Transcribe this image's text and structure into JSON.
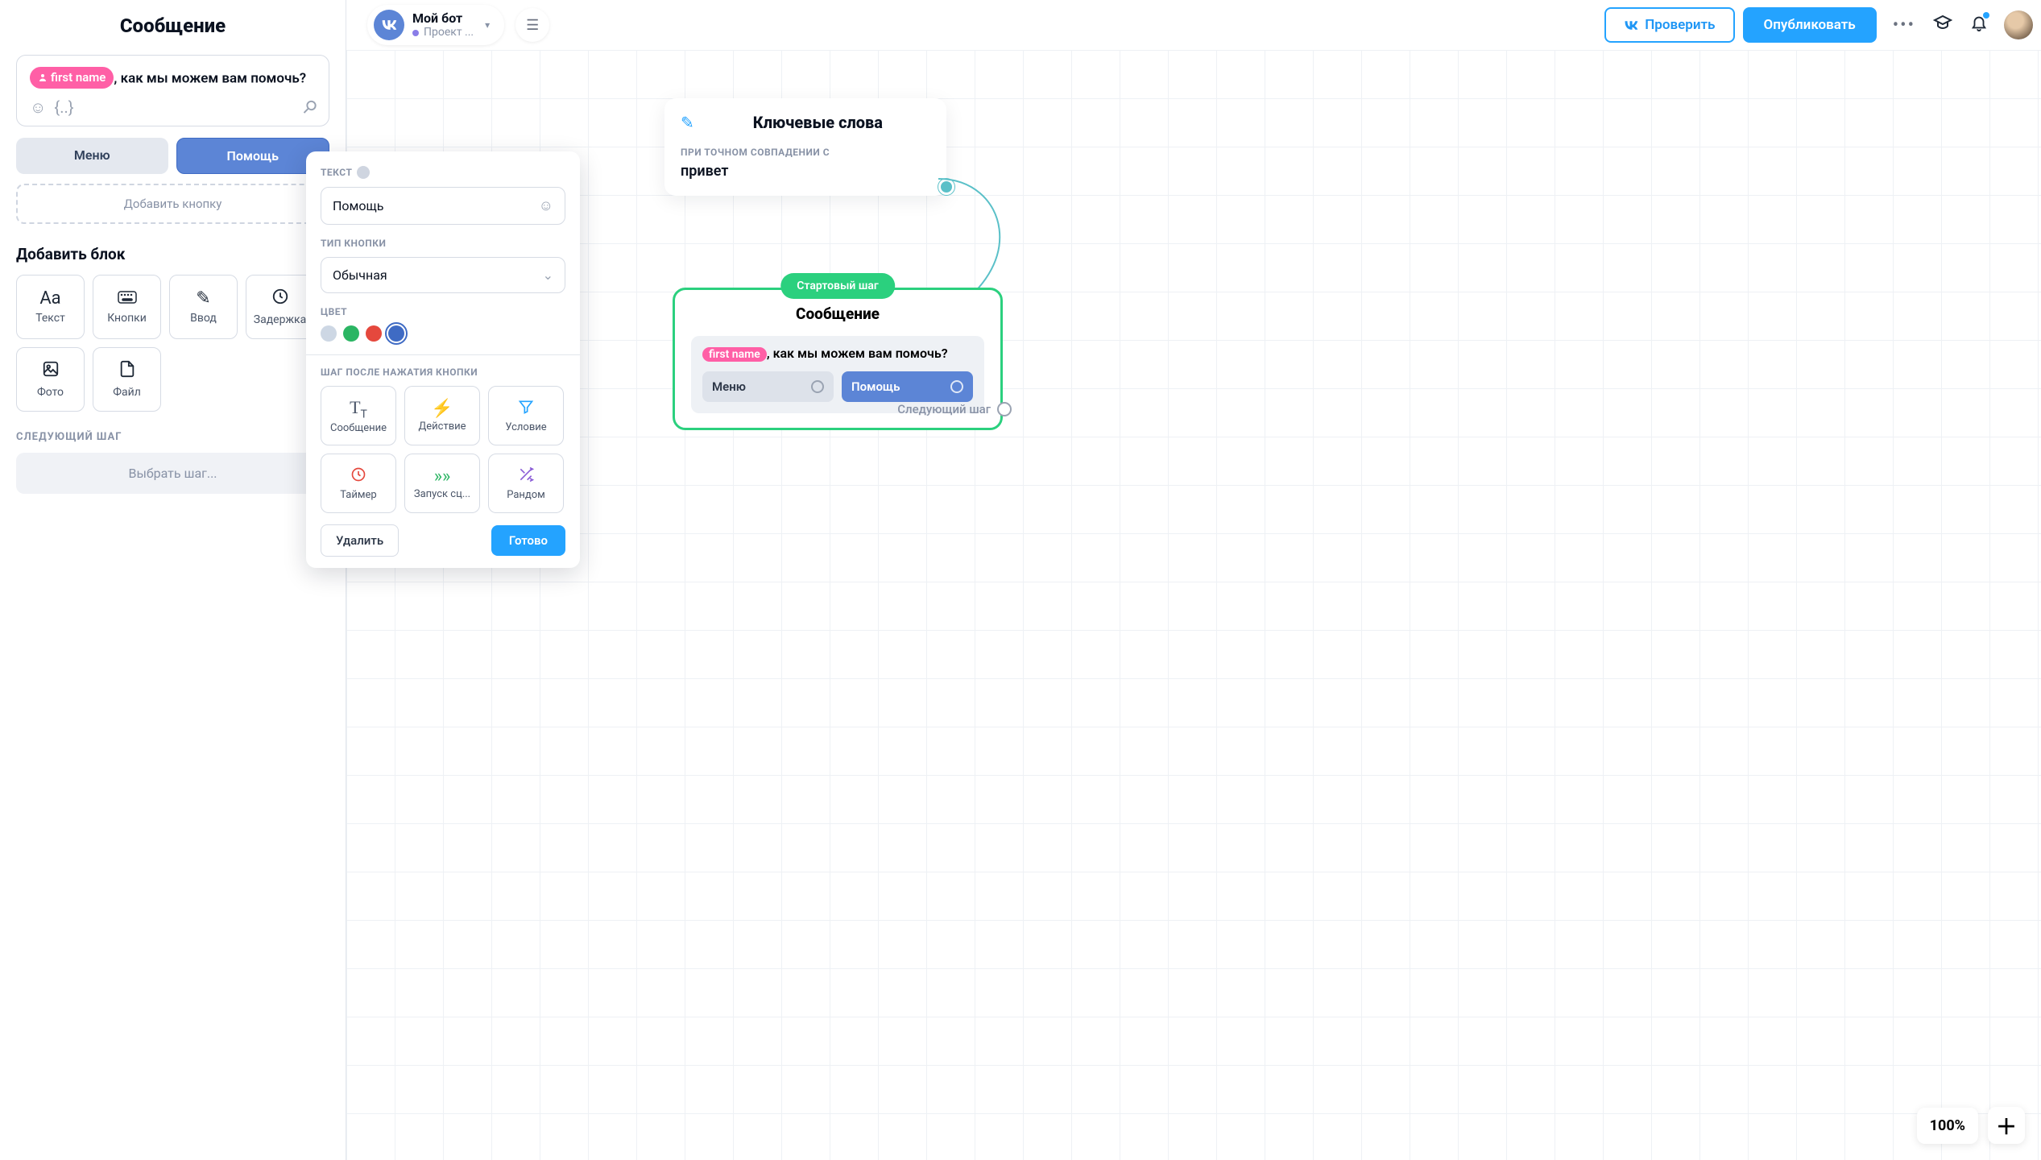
{
  "header": {
    "bot_name": "Мой бот",
    "project_label": "Проект ...",
    "test_label": "Проверить",
    "publish_label": "Опубликовать"
  },
  "left": {
    "title": "Сообщение",
    "msg_chip": "first name",
    "msg_rest": ", как мы можем вам помочь?",
    "btn_menu": "Меню",
    "btn_help": "Помощь",
    "add_button": "Добавить кнопку",
    "add_block": "Добавить блок",
    "blocks": {
      "text": "Текст",
      "buttons": "Кнопки",
      "input": "Ввод",
      "delay": "Задержка",
      "photo": "Фото",
      "file": "Файл"
    },
    "next_step_label": "СЛЕДУЮЩИЙ ШАГ",
    "select_step": "Выбрать шаг..."
  },
  "popup": {
    "text_label": "ТЕКСТ",
    "text_value": "Помощь",
    "type_label": "ТИП КНОПКИ",
    "type_value": "Обычная",
    "color_label": "ЦВЕТ",
    "colors": [
      "#cdd7e4",
      "#2bb563",
      "#e5483d",
      "#3f6bc4"
    ],
    "selected_color_index": 3,
    "step_label": "ШАГ ПОСЛЕ НАЖАТИЯ КНОПКИ",
    "steps": {
      "message": "Сообщение",
      "action": "Действие",
      "condition": "Условие",
      "timer": "Таймер",
      "launch": "Запуск сц...",
      "random": "Рандом"
    },
    "delete": "Удалить",
    "done": "Готово"
  },
  "nodes": {
    "keywords": {
      "title": "Ключевые слова",
      "sub": "ПРИ ТОЧНОМ СОВПАДЕНИИ С",
      "value": "привет"
    },
    "message": {
      "start_tag": "Стартовый шаг",
      "title": "Сообщение",
      "chip": "first name",
      "rest": ", как мы можем вам помочь?",
      "btn_menu": "Меню",
      "btn_help": "Помощь",
      "next": "Следующий шаг"
    }
  },
  "zoom": {
    "level": "100%"
  }
}
